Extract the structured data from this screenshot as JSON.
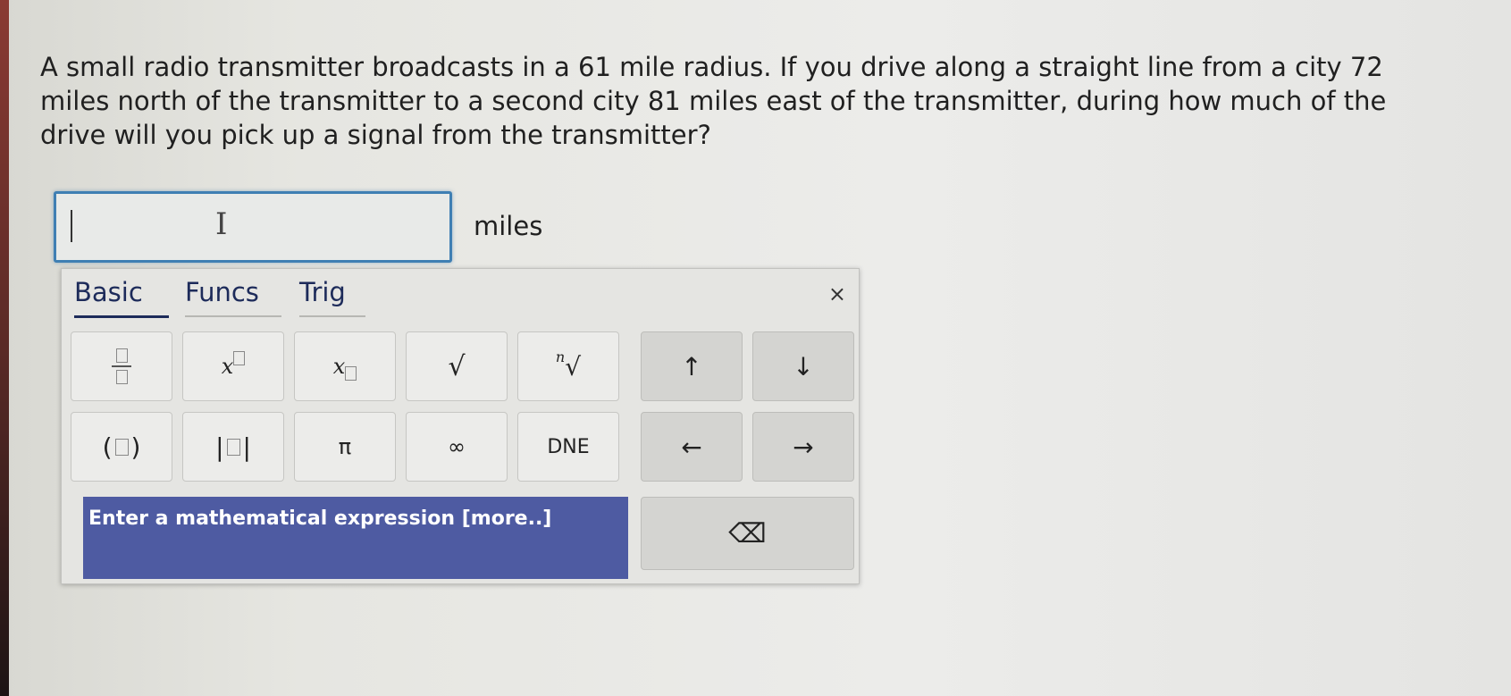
{
  "question": "A small radio transmitter broadcasts in a 61 mile radius. If you drive along a straight line from a city 72 miles north of the transmitter to a second city 81 miles east of the transmitter, during how much of the drive will you pick up a signal from the transmitter?",
  "answer": {
    "value": "",
    "units": "miles"
  },
  "keypad": {
    "tabs": [
      "Basic",
      "Funcs",
      "Trig"
    ],
    "close_label": "×",
    "keys": {
      "fraction": "fraction-icon",
      "power": "x",
      "subscript": "x",
      "sqrt": "√",
      "nth_root_index": "n",
      "nth_root": "√",
      "up": "↑",
      "down": "↓",
      "parens_open": "(",
      "parens_close": ")",
      "abs_bar": "|",
      "pi": "π",
      "infinity": "∞",
      "dne": "DNE",
      "left": "←",
      "right": "→",
      "backspace": "⌫"
    },
    "hint": "Enter a mathematical expression [more..]"
  }
}
